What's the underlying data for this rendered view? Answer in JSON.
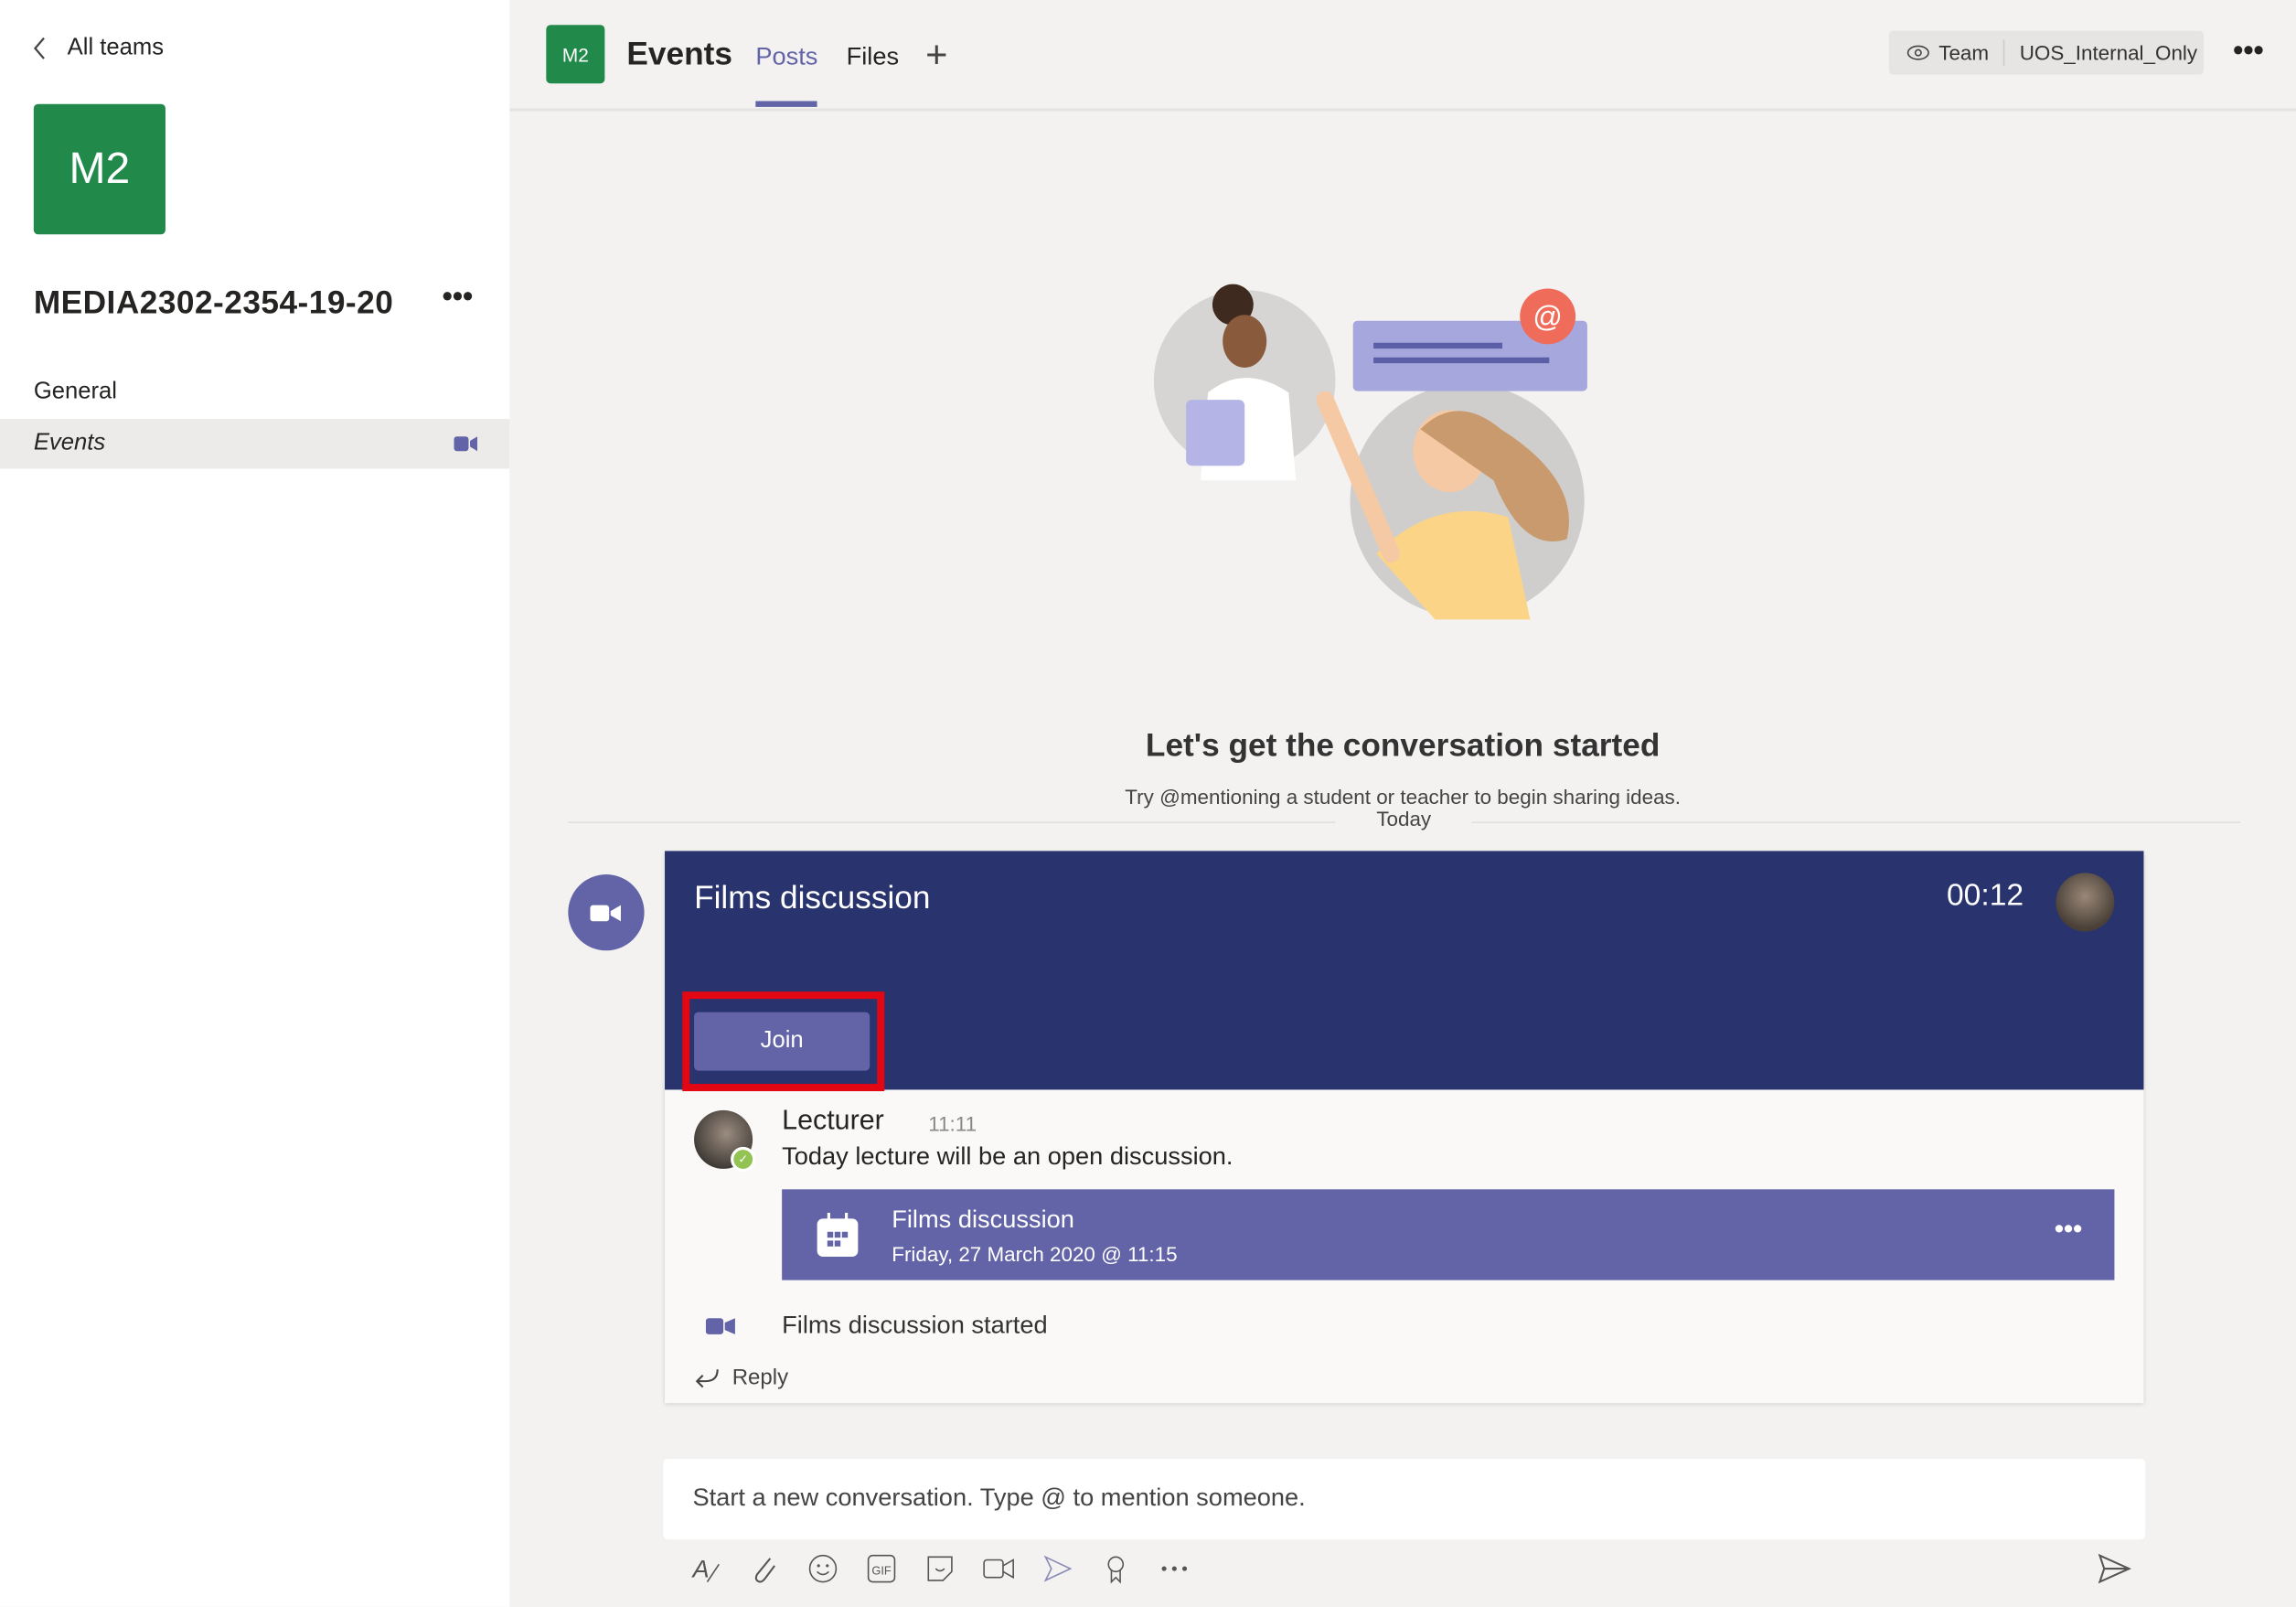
{
  "sidebar": {
    "back_label": "All teams",
    "team_initials": "M2",
    "team_name": "MEDIA2302-2354-19-20",
    "more": "•••",
    "channels": [
      {
        "label": "General"
      },
      {
        "label": "Events"
      }
    ]
  },
  "header": {
    "initials": "M2",
    "title": "Events",
    "tabs": [
      {
        "label": "Posts"
      },
      {
        "label": "Files"
      }
    ],
    "add_tab": "+",
    "visibility": "Team",
    "label": "UOS_Internal_Only",
    "more": "•••"
  },
  "empty_state": {
    "heading": "Let's get the conversation started",
    "subtext": "Try @mentioning a student or teacher to begin sharing ideas."
  },
  "separator": {
    "label": "Today"
  },
  "meeting": {
    "title": "Films discussion",
    "duration": "00:12",
    "join_label": "Join"
  },
  "post": {
    "author": "Lecturer",
    "time": "11:11",
    "message": "Today lecture will be an open discussion.",
    "event": {
      "title": "Films discussion",
      "date": "Friday, 27 March 2020 @ 11:15",
      "more": "•••"
    },
    "system_message": "Films discussion started",
    "reply_label": "Reply"
  },
  "compose": {
    "placeholder": "Start a new conversation. Type @ to mention someone."
  },
  "colors": {
    "brand": "#6264a7",
    "banner": "#29336e",
    "team": "#218a4b",
    "highlight": "#e30613"
  }
}
